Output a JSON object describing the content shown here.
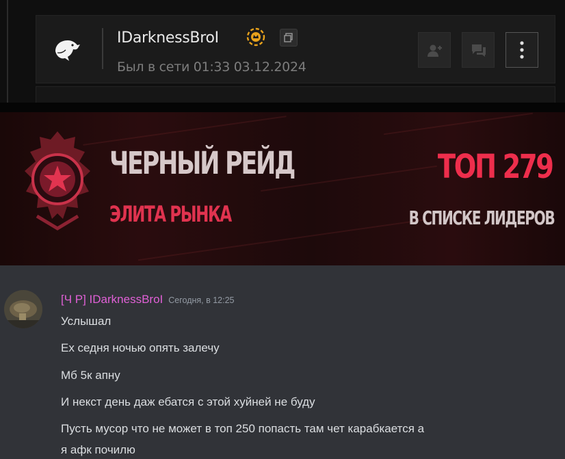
{
  "profile": {
    "username": "IDarknessBroI",
    "last_seen": "Был в сети 01:33 03.12.2024",
    "icons": {
      "avatar": "eagle-logo-icon",
      "badge": "crown-badge-icon",
      "copy": "copy-icon",
      "add_friend": "add-friend-icon",
      "message": "chat-icon",
      "more": "more-vertical-icon"
    }
  },
  "banner": {
    "title": "ЧЕРНЫЙ РЕЙД",
    "subtitle": "ЭЛИТА РЫНКА",
    "rank": "ТОП 279",
    "rank_caption": "В СПИСКЕ ЛИДЕРОВ",
    "colors": {
      "accent": "#ee2e4c",
      "text": "#d6c8c9"
    }
  },
  "message": {
    "author": "[Ч Р] IDarknessBroI",
    "timestamp": "Сегодня, в 12:25",
    "author_color": "#e060d6",
    "lines": [
      "Услышал",
      "Ех седня ночью опять залечу",
      "Мб 5к апну",
      "И некст день даж ебатся с этой хуйней не буду",
      "Пусть мусор что не может в топ 250 попасть там чет карабкается а",
      "я афк почилю"
    ]
  }
}
